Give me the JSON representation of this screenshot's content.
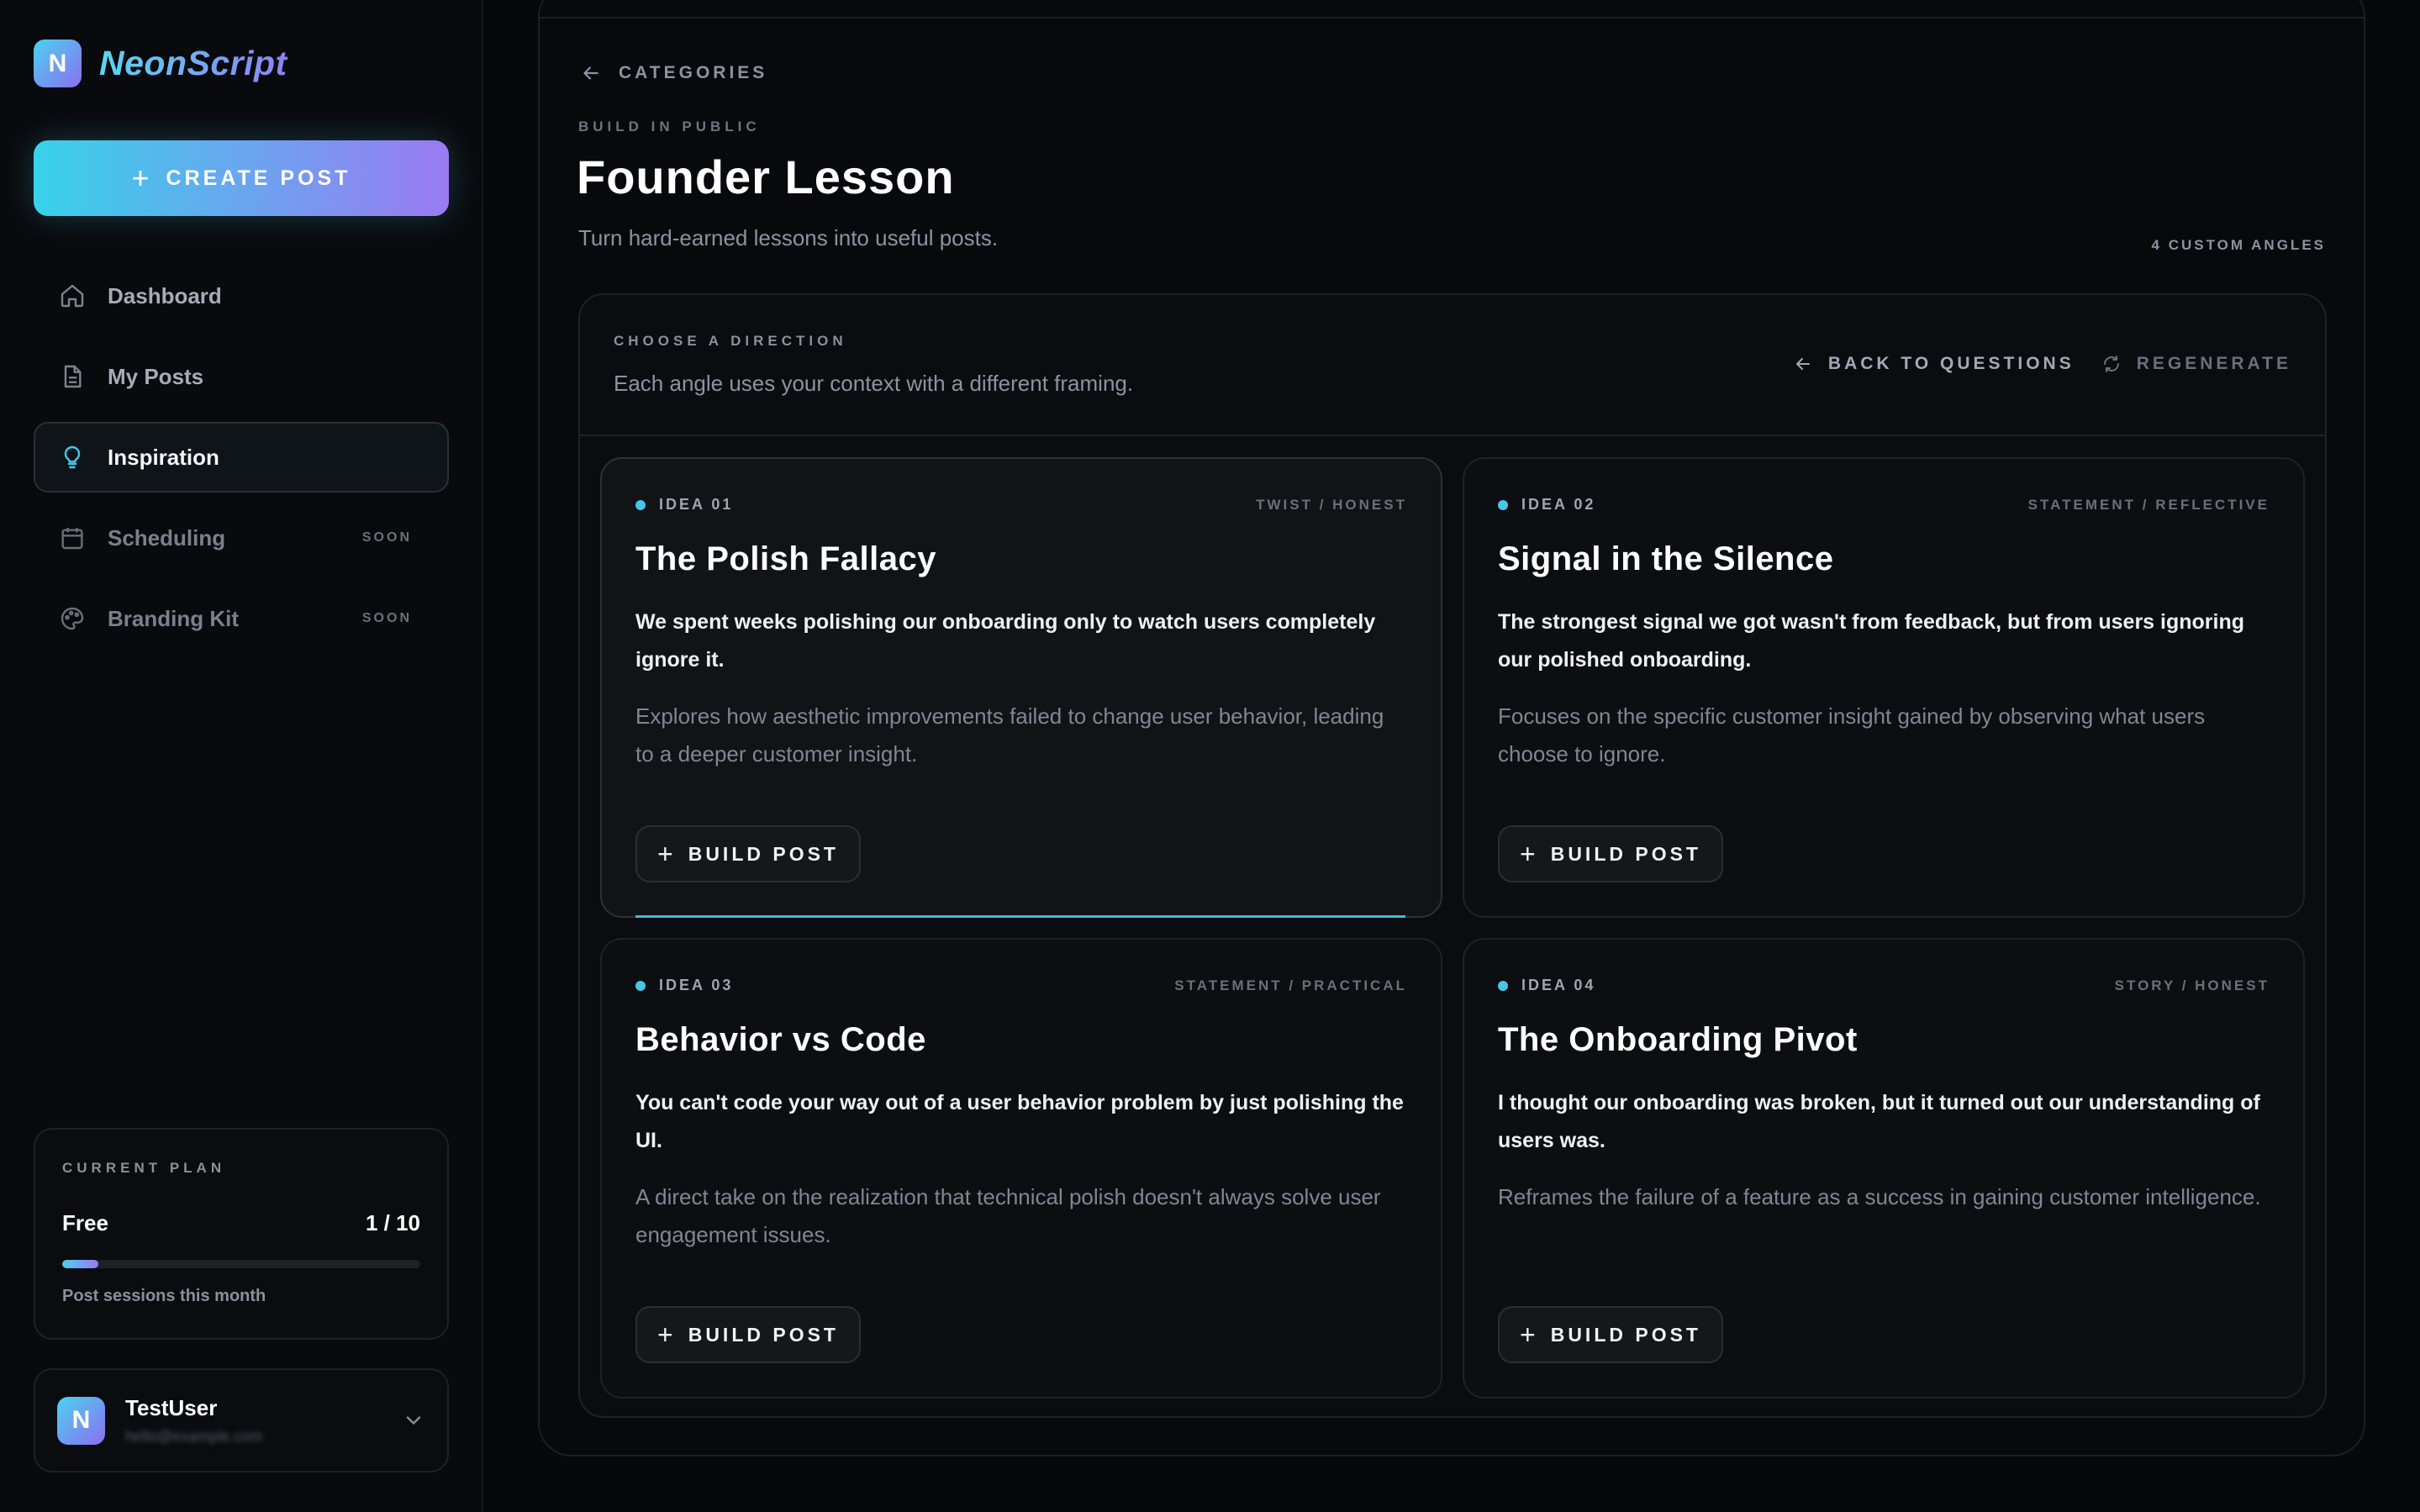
{
  "brand": {
    "logo_letter": "N",
    "name": "NeonScript"
  },
  "sidebar": {
    "create_label": "CREATE POST",
    "items": [
      {
        "label": "Dashboard",
        "icon": "home-icon",
        "active": false,
        "soon": ""
      },
      {
        "label": "My Posts",
        "icon": "document-icon",
        "active": false,
        "soon": ""
      },
      {
        "label": "Inspiration",
        "icon": "lightbulb-icon",
        "active": true,
        "soon": ""
      },
      {
        "label": "Scheduling",
        "icon": "calendar-icon",
        "active": false,
        "soon": "SOON"
      },
      {
        "label": "Branding Kit",
        "icon": "palette-icon",
        "active": false,
        "soon": "SOON"
      }
    ],
    "plan": {
      "label": "CURRENT PLAN",
      "name": "Free",
      "usage": "1 / 10",
      "progress_fraction": 0.1,
      "caption": "Post sessions this month"
    },
    "user": {
      "avatar_letter": "N",
      "name": "TestUser",
      "email": "hello@example.com"
    }
  },
  "main": {
    "breadcrumb": "CATEGORIES",
    "kicker": "BUILD IN PUBLIC",
    "title": "Founder Lesson",
    "subtitle": "Turn hard-earned lessons into useful posts.",
    "angles_count": "4 CUSTOM ANGLES",
    "direction": {
      "label": "CHOOSE A DIRECTION",
      "subtitle": "Each angle uses your context with a different framing.",
      "back_label": "BACK TO QUESTIONS",
      "regenerate_label": "REGENERATE"
    },
    "ideas": [
      {
        "number": "IDEA 01",
        "tag": "TWIST / HONEST",
        "title": "The Polish Fallacy",
        "hook": "We spent weeks polishing our onboarding only to watch users completely ignore it.",
        "description": "Explores how aesthetic improvements failed to change user behavior, leading to a deeper customer insight.",
        "button": "BUILD POST"
      },
      {
        "number": "IDEA 02",
        "tag": "STATEMENT / REFLECTIVE",
        "title": "Signal in the Silence",
        "hook": "The strongest signal we got wasn't from feedback, but from users ignoring our polished onboarding.",
        "description": "Focuses on the specific customer insight gained by observing what users choose to ignore.",
        "button": "BUILD POST"
      },
      {
        "number": "IDEA 03",
        "tag": "STATEMENT / PRACTICAL",
        "title": "Behavior vs Code",
        "hook": "You can't code your way out of a user behavior problem by just polishing the UI.",
        "description": "A direct take on the realization that technical polish doesn't always solve user engagement issues.",
        "button": "BUILD POST"
      },
      {
        "number": "IDEA 04",
        "tag": "STORY / HONEST",
        "title": "The Onboarding Pivot",
        "hook": "I thought our onboarding was broken, but it turned out our understanding of users was.",
        "description": "Reframes the failure of a feature as a success in gaining customer intelligence.",
        "button": "BUILD POST"
      }
    ]
  },
  "colors": {
    "accent_cyan": "#45c6ea",
    "accent_purple": "#9b7af3",
    "background": "#07080b"
  }
}
